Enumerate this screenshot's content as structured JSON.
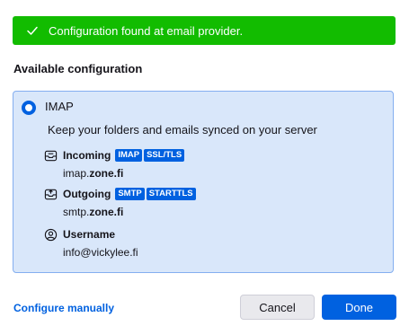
{
  "banner": {
    "text": "Configuration found at email provider.",
    "icon": "checkmark-icon",
    "color": "#12bc00"
  },
  "section_title": "Available configuration",
  "config": {
    "protocol": "IMAP",
    "selected": true,
    "description": "Keep your folders and emails synced on your server",
    "incoming": {
      "label": "Incoming",
      "tags": [
        "IMAP",
        "SSL/TLS"
      ],
      "host_prefix": "imap.",
      "host_domain": "zone.fi"
    },
    "outgoing": {
      "label": "Outgoing",
      "tags": [
        "SMTP",
        "STARTTLS"
      ],
      "host_prefix": "smtp.",
      "host_domain": "zone.fi"
    },
    "username": {
      "label": "Username",
      "value": "info@vickylee.fi"
    }
  },
  "footer": {
    "configure_manually": "Configure manually",
    "cancel": "Cancel",
    "done": "Done"
  },
  "colors": {
    "accent": "#0061e0",
    "box_bg": "#d9e7fa",
    "box_border": "#84aef0"
  }
}
